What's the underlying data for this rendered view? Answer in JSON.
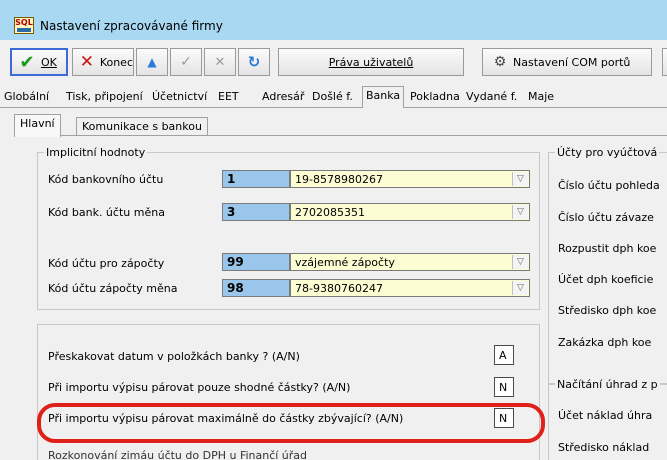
{
  "window": {
    "title": "Nastavení zpracovávané firmy",
    "app_logo_text": "SQL"
  },
  "toolbar": {
    "ok_label": "OK",
    "konec_label": "Konec",
    "prava_label": "Práva uživatelů",
    "com_label": "Nastavení COM portů"
  },
  "menu_tabs": [
    "Globální",
    "Tisk, připojení",
    "Účetnictví",
    "EET",
    "Adresář",
    "Došlé f.",
    "Banka",
    "Pokladna",
    "Vydané f.",
    "Maje"
  ],
  "sub_tabs": [
    "Hlavní",
    "Komunikace s bankou"
  ],
  "implicit": {
    "title": "Implicitní hodnoty",
    "rows": [
      {
        "label": "Kód bankovního účtu",
        "code": "1",
        "value": "19-8578980267"
      },
      {
        "label": "Kód bank. účtu měna",
        "code": "3",
        "value": "2702085351"
      },
      {
        "label": "Kód účtu pro zápočty",
        "code": "99",
        "value": "vzájemné zápočty"
      },
      {
        "label": "Kód účtu zápočty měna",
        "code": "98",
        "value": "78-9380760247"
      }
    ]
  },
  "options": [
    {
      "label": "Přeskakovat datum v položkách banky ? (A/N)",
      "value": "A"
    },
    {
      "label": "Při importu výpisu párovat pouze shodné částky? (A/N)",
      "value": "N"
    },
    {
      "label": "Při importu výpisu párovat maximálně do částky zbývající? (A/N)",
      "value": "N"
    },
    {
      "label": "Rozkonování zimáu účtu do DPH u Finančí úřad",
      "value": ""
    }
  ],
  "right": {
    "group1_title": "Účty pro vyúčtová",
    "group1_items": [
      "Číslo účtu pohleda",
      "Číslo účtu závaze",
      "Rozpustit dph koe",
      "Účet dph koeficie",
      "Středisko dph koe",
      "Zakázka dph koe"
    ],
    "group2_title": "Načítání úhrad z p",
    "group2_items": [
      "Účet náklad úhra",
      "Středisko náklad"
    ]
  },
  "colors": {
    "highlight": "#e0201a",
    "code_bg": "#99c6ea",
    "value_bg": "#fdfdd4",
    "titlebar": "#a8d8f2"
  }
}
